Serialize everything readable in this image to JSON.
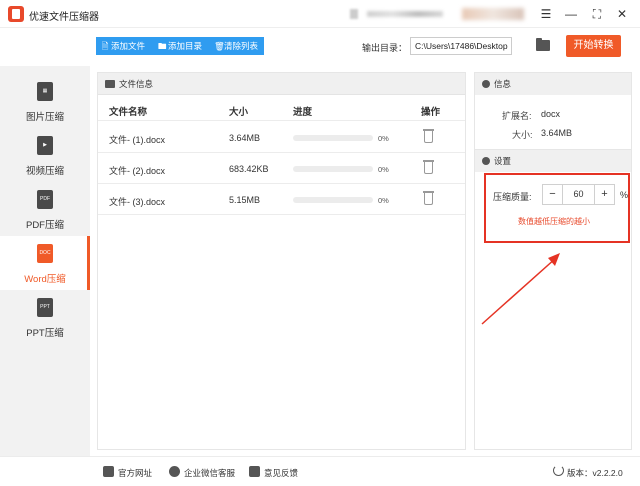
{
  "window": {
    "title": "优速文件压缩器",
    "icons": {
      "menu": "hamburger-icon",
      "minimize": "minimize-icon",
      "maximize": "maximize-icon",
      "close": "close-icon"
    }
  },
  "toolbar": {
    "add_file": "添加文件",
    "add_folder": "添加目录",
    "clear_list": "清除列表",
    "output_label": "输出目录：",
    "output_path": "C:\\Users\\17486\\Desktop",
    "start_button": "开始转换",
    "colors": {
      "action_blue": "#2f9cf0",
      "start_orange": "#f05a28"
    }
  },
  "sidebar": {
    "items": [
      {
        "label": "图片压缩",
        "icon": "image-file-icon",
        "badge": ""
      },
      {
        "label": "视频压缩",
        "icon": "video-file-icon",
        "badge": ""
      },
      {
        "label": "PDF压缩",
        "icon": "pdf-file-icon",
        "badge": "PDF"
      },
      {
        "label": "Word压缩",
        "icon": "doc-file-icon",
        "badge": "DOC",
        "active": true
      },
      {
        "label": "PPT压缩",
        "icon": "ppt-file-icon",
        "badge": "PPT"
      }
    ]
  },
  "file_panel": {
    "header": "文件信息",
    "columns": [
      "文件名称",
      "大小",
      "进度",
      "操作"
    ],
    "rows": [
      {
        "name": "文件- (1).docx",
        "size": "3.64MB",
        "progress": "0%",
        "progress_value": 0
      },
      {
        "name": "文件- (2).docx",
        "size": "683.42KB",
        "progress": "0%",
        "progress_value": 0
      },
      {
        "name": "文件- (3).docx",
        "size": "5.15MB",
        "progress": "0%",
        "progress_value": 0
      }
    ]
  },
  "info_panel": {
    "header": "信息",
    "ext_label": "扩展名:",
    "ext_value": "docx",
    "size_label": "大小:",
    "size_value": "3.64MB"
  },
  "settings_panel": {
    "header": "设置",
    "quality_label": "压缩质量:",
    "quality_value": "60",
    "minus": "−",
    "plus": "+",
    "unit": "%",
    "hint": "数值越低压缩的越小"
  },
  "footer": {
    "website": "官方网址",
    "wechat": "企业微信客服",
    "feedback": "意见反馈",
    "version": "版本：v2.2.2.0"
  }
}
